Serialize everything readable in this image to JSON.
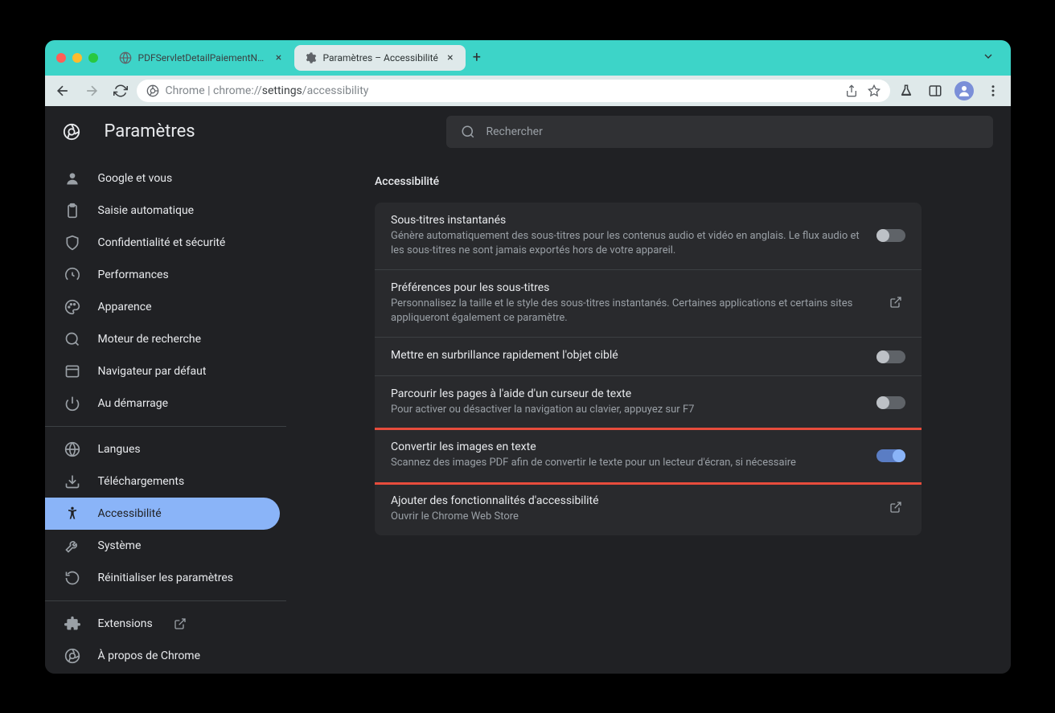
{
  "tabs": [
    {
      "title": "PDFServletDetailPaiementNont",
      "active": false
    },
    {
      "title": "Paramètres – Accessibilité",
      "active": true
    }
  ],
  "url": {
    "prefix": "Chrome",
    "scheme": "chrome://",
    "path_bold": "settings",
    "path_rest": "/accessibility"
  },
  "settings_title": "Paramètres",
  "search_placeholder": "Rechercher",
  "sidebar": {
    "items_top": [
      {
        "label": "Google et vous",
        "icon": "person"
      },
      {
        "label": "Saisie automatique",
        "icon": "clipboard"
      },
      {
        "label": "Confidentialité et sécurité",
        "icon": "shield"
      },
      {
        "label": "Performances",
        "icon": "speed"
      },
      {
        "label": "Apparence",
        "icon": "palette"
      },
      {
        "label": "Moteur de recherche",
        "icon": "search"
      },
      {
        "label": "Navigateur par défaut",
        "icon": "browser"
      },
      {
        "label": "Au démarrage",
        "icon": "power"
      }
    ],
    "items_mid": [
      {
        "label": "Langues",
        "icon": "globe"
      },
      {
        "label": "Téléchargements",
        "icon": "download"
      },
      {
        "label": "Accessibilité",
        "icon": "accessibility",
        "active": true
      },
      {
        "label": "Système",
        "icon": "wrench"
      },
      {
        "label": "Réinitialiser les paramètres",
        "icon": "reset"
      }
    ],
    "items_bottom": [
      {
        "label": "Extensions",
        "icon": "puzzle",
        "external": true
      },
      {
        "label": "À propos de Chrome",
        "icon": "chrome"
      }
    ]
  },
  "section": {
    "title": "Accessibilité",
    "rows": [
      {
        "title": "Sous-titres instantanés",
        "desc": "Génère automatiquement des sous-titres pour les contenus audio et vidéo en anglais. Le flux audio et les sous-titres ne sont jamais exportés hors de votre appareil.",
        "control": "toggle",
        "on": false
      },
      {
        "title": "Préférences pour les sous-titres",
        "desc": "Personnalisez la taille et le style des sous-titres instantanés. Certaines applications et certains sites appliqueront également ce paramètre.",
        "control": "link"
      },
      {
        "title": "Mettre en surbrillance rapidement l'objet ciblé",
        "desc": "",
        "control": "toggle",
        "on": false
      },
      {
        "title": "Parcourir les pages à l'aide d'un curseur de texte",
        "desc": "Pour activer ou désactiver la navigation au clavier, appuyez sur F7",
        "control": "toggle",
        "on": false
      },
      {
        "title": "Convertir les images en texte",
        "desc": "Scannez des images PDF afin de convertir le texte pour un lecteur d'écran, si nécessaire",
        "control": "toggle",
        "on": true,
        "highlighted": true
      },
      {
        "title": "Ajouter des fonctionnalités d'accessibilité",
        "desc": "Ouvrir le Chrome Web Store",
        "control": "link"
      }
    ]
  }
}
